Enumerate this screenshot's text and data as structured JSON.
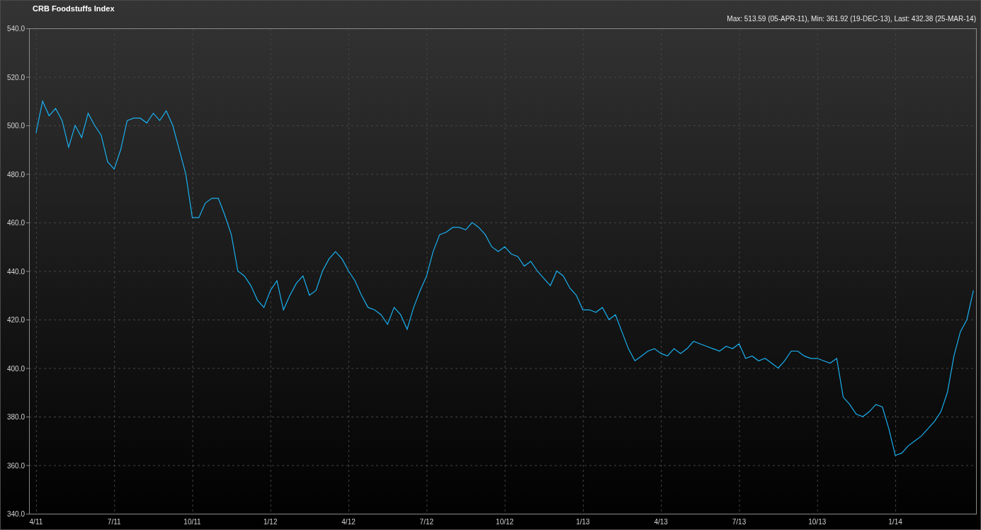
{
  "summary": "Max: 513.59 (05-APR-11), Min: 361.92 (19-DEC-13), Last: 432.38 (25-MAR-14)",
  "chart_data": {
    "type": "line",
    "title": "CRB Foodstuffs Index",
    "categories": [
      "4/11",
      null,
      null,
      null,
      null,
      null,
      null,
      null,
      null,
      null,
      null,
      null,
      "7/11",
      null,
      null,
      null,
      null,
      null,
      null,
      null,
      null,
      null,
      null,
      null,
      "10/11",
      null,
      null,
      null,
      null,
      null,
      null,
      null,
      null,
      null,
      null,
      null,
      "1/12",
      null,
      null,
      null,
      null,
      null,
      null,
      null,
      null,
      null,
      null,
      null,
      "4/12",
      null,
      null,
      null,
      null,
      null,
      null,
      null,
      null,
      null,
      null,
      null,
      "7/12",
      null,
      null,
      null,
      null,
      null,
      null,
      null,
      null,
      null,
      null,
      null,
      "10/12",
      null,
      null,
      null,
      null,
      null,
      null,
      null,
      null,
      null,
      null,
      null,
      "1/13",
      null,
      null,
      null,
      null,
      null,
      null,
      null,
      null,
      null,
      null,
      null,
      "4/13",
      null,
      null,
      null,
      null,
      null,
      null,
      null,
      null,
      null,
      null,
      null,
      "7/13",
      null,
      null,
      null,
      null,
      null,
      null,
      null,
      null,
      null,
      null,
      null,
      "10/13",
      null,
      null,
      null,
      null,
      null,
      null,
      null,
      null,
      null,
      null,
      null,
      "1/14",
      null,
      null,
      null,
      null,
      null,
      null,
      null,
      null,
      null,
      null,
      null,
      null
    ],
    "series": [
      {
        "color": "#1ab0f0",
        "values": [
          497,
          510,
          504,
          507,
          502,
          491,
          500,
          495,
          505,
          500,
          496,
          485,
          482,
          490,
          502,
          503,
          503,
          501,
          505,
          502,
          506,
          500,
          490,
          480,
          462,
          462,
          468,
          470,
          470,
          463,
          455,
          440,
          438,
          434,
          428,
          425,
          432,
          436,
          424,
          430,
          435,
          438,
          430,
          432,
          440,
          445,
          448,
          445,
          440,
          436,
          430,
          425,
          424,
          422,
          418,
          425,
          422,
          416,
          425,
          432,
          438,
          448,
          455,
          456,
          458,
          458,
          457,
          460,
          458,
          455,
          450,
          448,
          450,
          447,
          446,
          442,
          444,
          440,
          437,
          434,
          440,
          438,
          433,
          430,
          424,
          424,
          423,
          425,
          420,
          422,
          415,
          408,
          403,
          405,
          407,
          408,
          406,
          405,
          408,
          406,
          408,
          411,
          410,
          409,
          408,
          407,
          409,
          408,
          410,
          404,
          405,
          403,
          404,
          402,
          400,
          403,
          407,
          407,
          405,
          404,
          404,
          403,
          402,
          404,
          388,
          385,
          381,
          380,
          382,
          385,
          384,
          375,
          364,
          365,
          368,
          370,
          372,
          375,
          378,
          382,
          390,
          405,
          415,
          420,
          432
        ]
      }
    ],
    "grid": true,
    "ylim": [
      340,
      540
    ],
    "yticks": [
      {
        "value": 340,
        "label": "340.0"
      },
      {
        "value": 360,
        "label": "360.0"
      },
      {
        "value": 380,
        "label": "380.0"
      },
      {
        "value": 400,
        "label": "400.0"
      },
      {
        "value": 420,
        "label": "420.0"
      },
      {
        "value": 440,
        "label": "440.0"
      },
      {
        "value": 460,
        "label": "460.0"
      },
      {
        "value": 480,
        "label": "480.0"
      },
      {
        "value": 500,
        "label": "500.0"
      },
      {
        "value": 520,
        "label": "520.0"
      },
      {
        "value": 540,
        "label": "540.0"
      }
    ]
  }
}
